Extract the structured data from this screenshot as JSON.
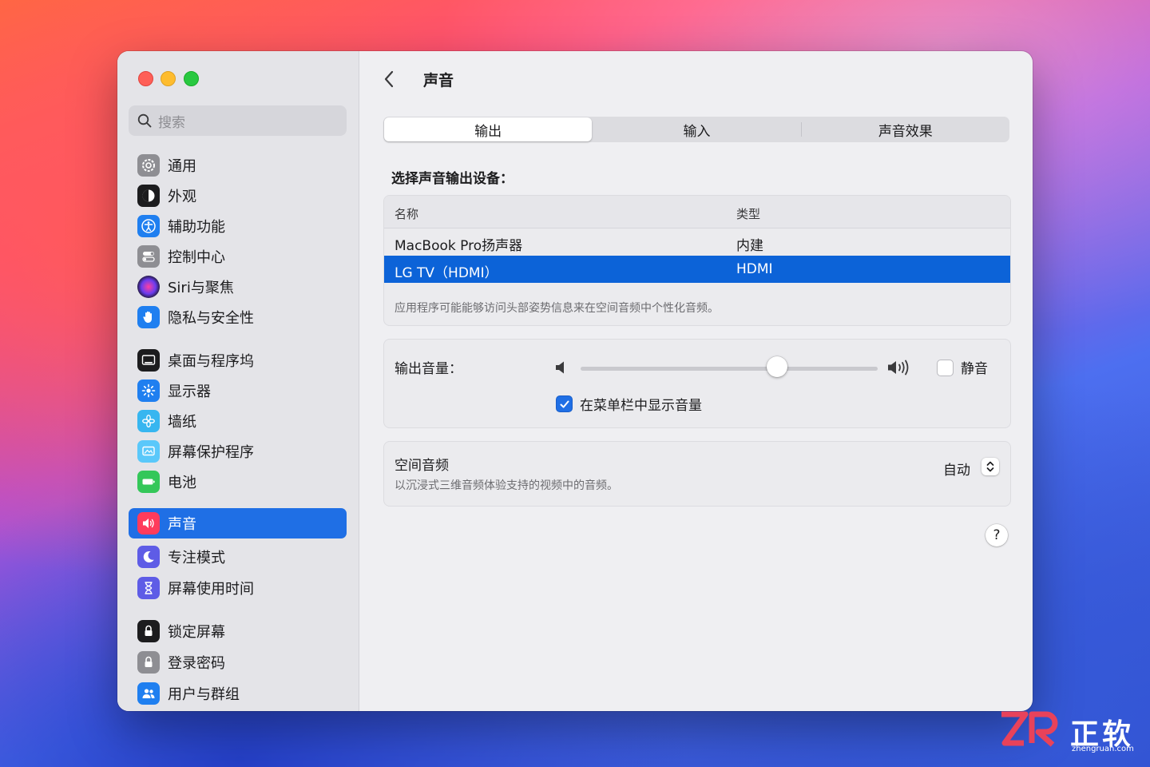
{
  "colors": {
    "accent": "#1f6fe5",
    "selection": "#0c63d8",
    "close": "#fe5f57",
    "minimize": "#febc2e",
    "zoom": "#28c840"
  },
  "sidebar": {
    "search_placeholder": "搜索",
    "items": [
      {
        "label": "通用",
        "icon": "gear-icon"
      },
      {
        "label": "外观",
        "icon": "appearance-icon"
      },
      {
        "label": "辅助功能",
        "icon": "accessibility-icon"
      },
      {
        "label": "控制中心",
        "icon": "control-center-icon"
      },
      {
        "label": "Siri与聚焦",
        "icon": "siri-icon"
      },
      {
        "label": "隐私与安全性",
        "icon": "hand-icon"
      },
      {
        "label": "桌面与程序坞",
        "icon": "dock-icon"
      },
      {
        "label": "显示器",
        "icon": "brightness-icon"
      },
      {
        "label": "墙纸",
        "icon": "flower-icon"
      },
      {
        "label": "屏幕保护程序",
        "icon": "screensaver-icon"
      },
      {
        "label": "电池",
        "icon": "battery-icon"
      },
      {
        "label": "声音",
        "icon": "speaker-icon",
        "active": true
      },
      {
        "label": "专注模式",
        "icon": "moon-icon"
      },
      {
        "label": "屏幕使用时间",
        "icon": "hourglass-icon"
      },
      {
        "label": "锁定屏幕",
        "icon": "lock-screen-icon"
      },
      {
        "label": "登录密码",
        "icon": "lock-icon"
      },
      {
        "label": "用户与群组",
        "icon": "users-icon"
      }
    ]
  },
  "main": {
    "title": "声音",
    "tabs": [
      {
        "label": "输出",
        "active": true
      },
      {
        "label": "输入"
      },
      {
        "label": "声音效果"
      }
    ],
    "output_heading": "选择声音输出设备：",
    "device_table": {
      "columns": [
        "名称",
        "类型"
      ],
      "rows": [
        {
          "name": "MacBook Pro扬声器",
          "type": "内建"
        },
        {
          "name": "LG TV（HDMI）",
          "type": "HDMI",
          "selected": true
        }
      ],
      "note": "应用程序可能能够访问头部姿势信息来在空间音频中个性化音频。"
    },
    "volume": {
      "label": "输出音量：",
      "level": 0.66,
      "mute_label": "静音",
      "mute_checked": false,
      "menubar_label": "在菜单栏中显示音量",
      "menubar_checked": true
    },
    "spatial": {
      "title": "空间音频",
      "description": "以沉浸式三维音频体验支持的视频中的音频。",
      "value": "自动"
    },
    "help_label": "?"
  },
  "watermark": {
    "brand": "正软",
    "url": "zhengruan.com"
  }
}
